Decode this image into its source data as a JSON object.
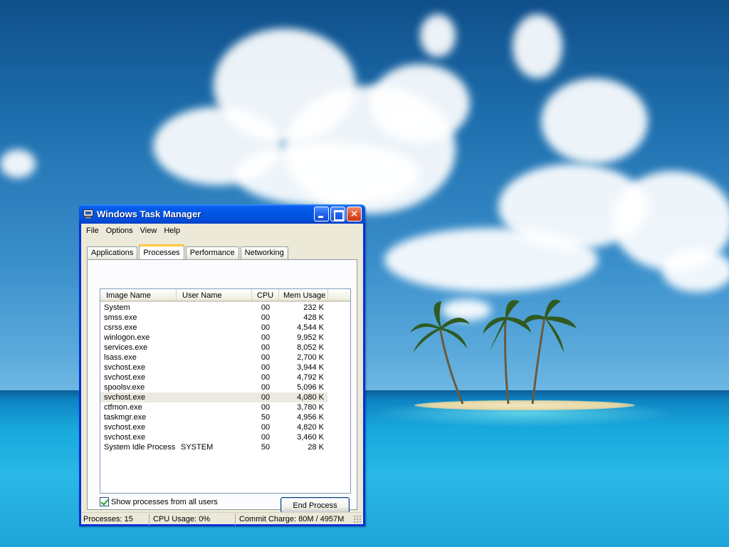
{
  "window": {
    "title": "Windows Task Manager",
    "buttons": {
      "minimize": "minimize-icon",
      "maximize": "maximize-icon",
      "close": "close-icon"
    }
  },
  "menu": [
    "File",
    "Options",
    "View",
    "Help"
  ],
  "tabs": [
    "Applications",
    "Processes",
    "Performance",
    "Networking"
  ],
  "active_tab": "Processes",
  "columns": {
    "image": "Image Name",
    "user": "User Name",
    "cpu": "CPU",
    "mem": "Mem Usage"
  },
  "processes": [
    {
      "image": "System",
      "user": "",
      "cpu": "00",
      "mem": "232 K"
    },
    {
      "image": "smss.exe",
      "user": "",
      "cpu": "00",
      "mem": "428 K"
    },
    {
      "image": "csrss.exe",
      "user": "",
      "cpu": "00",
      "mem": "4,544 K"
    },
    {
      "image": "winlogon.exe",
      "user": "",
      "cpu": "00",
      "mem": "9,952 K"
    },
    {
      "image": "services.exe",
      "user": "",
      "cpu": "00",
      "mem": "8,052 K"
    },
    {
      "image": "lsass.exe",
      "user": "",
      "cpu": "00",
      "mem": "2,700 K"
    },
    {
      "image": "svchost.exe",
      "user": "",
      "cpu": "00",
      "mem": "3,944 K"
    },
    {
      "image": "svchost.exe",
      "user": "",
      "cpu": "00",
      "mem": "4,792 K"
    },
    {
      "image": "spoolsv.exe",
      "user": "",
      "cpu": "00",
      "mem": "5,096 K"
    },
    {
      "image": "svchost.exe",
      "user": "",
      "cpu": "00",
      "mem": "4,080 K"
    },
    {
      "image": "ctfmon.exe",
      "user": "",
      "cpu": "00",
      "mem": "3,780 K"
    },
    {
      "image": "taskmgr.exe",
      "user": "",
      "cpu": "50",
      "mem": "4,956 K"
    },
    {
      "image": "svchost.exe",
      "user": "",
      "cpu": "00",
      "mem": "4,820 K"
    },
    {
      "image": "svchost.exe",
      "user": "",
      "cpu": "00",
      "mem": "3,460 K"
    },
    {
      "image": "System Idle Process",
      "user": "SYSTEM",
      "cpu": "50",
      "mem": "28 K"
    }
  ],
  "selected_row": 9,
  "show_all_users": {
    "label": "Show processes from all users",
    "checked": true
  },
  "end_process_label": "End Process",
  "status": {
    "processes": "Processes: 15",
    "cpu": "CPU Usage: 0%",
    "commit": "Commit Charge: 80M / 4957M"
  },
  "colors": {
    "title_bar": "#0054e3",
    "window_bg": "#ece9d8",
    "active_tab_accent": "#ffc83c",
    "selected_row": "#ebe9e0"
  }
}
